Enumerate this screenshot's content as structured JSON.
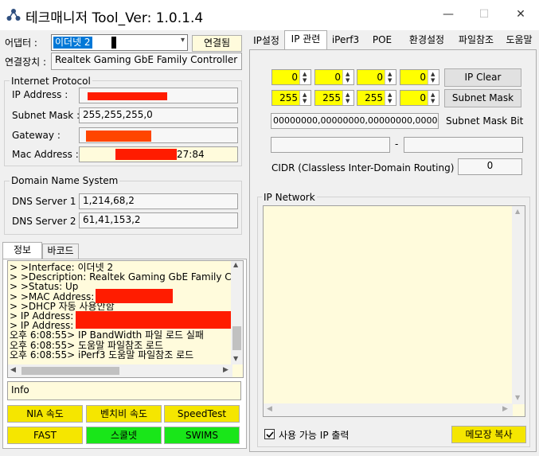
{
  "window": {
    "title": "테크매니저 Tool_Ver: 1.0.1.4",
    "minimize": "—",
    "maximize": "☐",
    "close": "✕"
  },
  "left": {
    "adapter_label": "어댑터 :",
    "adapter_value": "이더넷 2",
    "connect_button": "연결됨",
    "device_label": "연결장치 :",
    "device_value": "Realtek Gaming GbE Family Controller",
    "ip_group_title": "Internet Protocol",
    "ip_label": "IP Address :",
    "subnet_label": "Subnet Mask :",
    "subnet_value": "255,255,255,0",
    "gateway_label": "Gateway :",
    "mac_label": "Mac Address :",
    "mac_suffix": "27:84",
    "dns_group_title": "Domain Name System",
    "dns1_label": "DNS Server 1 :",
    "dns1_value": "1,214,68,2",
    "dns2_label": "DNS Server 2 :",
    "dns2_value": "61,41,153,2",
    "tabs": [
      "정보",
      "바코드"
    ],
    "log_lines": [
      "> >Interface: 이더넷 2",
      "> >Description: Realtek Gaming GbE Family Con",
      "> >Status: Up",
      "> >MAC Address:",
      "> >DHCP 자동 사용안함",
      "> IP Address:",
      "> IP Address:",
      "오후 6:08:55> IP BandWidth 파일 로드 실패",
      "오후 6:08:55> 도움말 파일참조 로드",
      "오후 6:08:55> iPerf3 도움말 파일참조 로드"
    ],
    "info_text": "Info",
    "buttons": {
      "nia": "NIA 속도",
      "benchbee": "벤치비 속도",
      "speedtest": "SpeedTest",
      "fast": "FAST",
      "schoolnet": "스쿨넷",
      "swims": "SWIMS"
    }
  },
  "right": {
    "tabs": [
      "IP설정",
      "IP 관련",
      "iPerf3",
      "POE",
      "환경설정",
      "파일참조",
      "도움말"
    ],
    "ip_octets": [
      "0",
      "0",
      "0",
      "0"
    ],
    "ip_clear_button": "IP Clear",
    "mask_octets": [
      "255",
      "255",
      "255",
      "0"
    ],
    "subnet_mask_button": "Subnet Mask",
    "mask_bits_value": "00000000,00000000,00000000,00000000",
    "mask_bits_label": "Subnet Mask Bit",
    "range_dash": "-",
    "cidr_label": "CIDR (Classless Inter-Domain Routing)",
    "cidr_value": "0",
    "network_group_title": "IP Network",
    "available_ip_checkbox": "사용 가능 IP  출력",
    "notepad_copy_button": "메모장 복사"
  },
  "colors": {
    "yellow_input": "#ffff00",
    "yellow_button": "#f5e600",
    "green_button": "#19e619",
    "log_background": "#fffbdc",
    "redaction": "#ff1c00"
  }
}
